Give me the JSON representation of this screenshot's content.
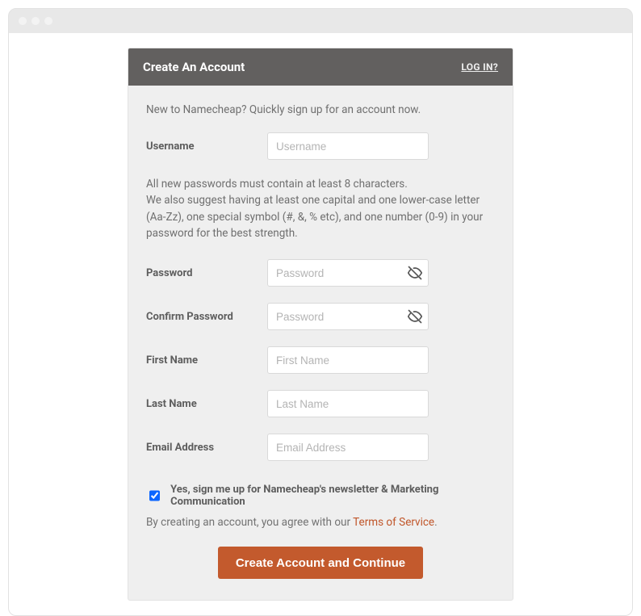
{
  "header": {
    "title": "Create An Account",
    "login": "LOG IN?"
  },
  "intro": "New to Namecheap? Quickly sign up for an account now.",
  "password_note": "All new passwords must contain at least 8 characters.\nWe also suggest having at least one capital and one lower-case letter (Aa-Zz), one special symbol (#, &, % etc), and one number (0-9) in your password for the best strength.",
  "fields": {
    "username": {
      "label": "Username",
      "placeholder": "Username",
      "value": ""
    },
    "password": {
      "label": "Password",
      "placeholder": "Password",
      "value": ""
    },
    "confirm_password": {
      "label": "Confirm Password",
      "placeholder": "Password",
      "value": ""
    },
    "first_name": {
      "label": "First Name",
      "placeholder": "First Name",
      "value": ""
    },
    "last_name": {
      "label": "Last Name",
      "placeholder": "Last Name",
      "value": ""
    },
    "email": {
      "label": "Email Address",
      "placeholder": "Email Address",
      "value": ""
    }
  },
  "newsletter": {
    "checked": true,
    "label": "Yes, sign me up for Namecheap's newsletter & Marketing Communication"
  },
  "terms": {
    "prefix": "By creating an account, you agree with our ",
    "link_text": "Terms of Service",
    "suffix": "."
  },
  "submit_label": "Create Account and Continue",
  "icons": {
    "eye_off": "eye-off-icon"
  }
}
